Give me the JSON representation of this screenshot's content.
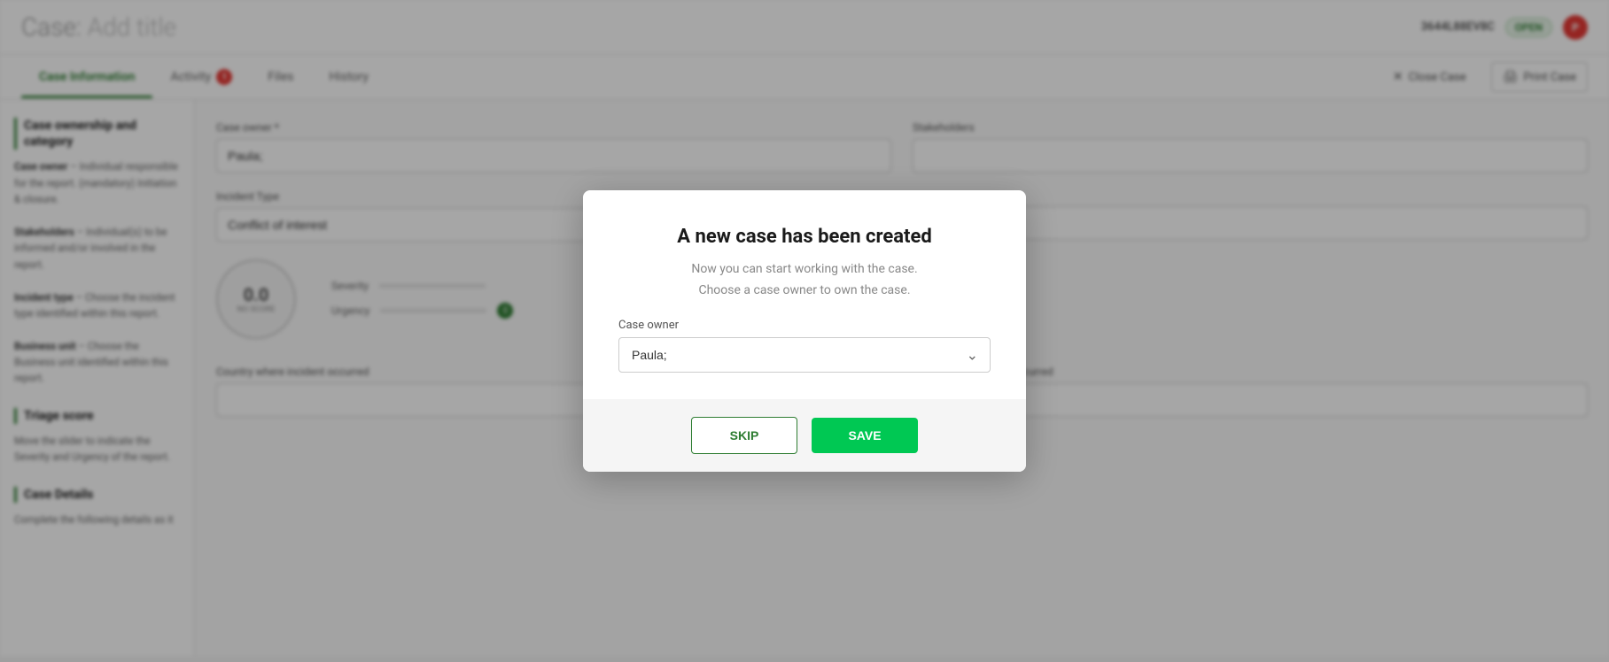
{
  "header": {
    "title_prefix": "Case:",
    "title_placeholder": "Add title",
    "case_id": "3644L88EV8C",
    "status": "OPEN",
    "avatar_initials": "P"
  },
  "tabs": [
    {
      "id": "case-information",
      "label": "Case Information",
      "active": true,
      "badge": null
    },
    {
      "id": "activity",
      "label": "Activity",
      "active": false,
      "badge": "1"
    },
    {
      "id": "files",
      "label": "Files",
      "active": false,
      "badge": null
    },
    {
      "id": "history",
      "label": "History",
      "active": false,
      "badge": null
    }
  ],
  "tabs_right": {
    "close_case": "Close Case",
    "print_case": "Print Case"
  },
  "sidebar": {
    "sections": [
      {
        "id": "case-ownership",
        "title": "Case ownership and category",
        "body": "Case owner – Individual responsible for the report. (mandatory) Initiation & closure.\nStakeholders – Individual(s) to be informed and/or involved in the report.\nIncident type – Choose the incident type identified within this report.\nBusiness unit – Choose the Business unit identified within this report."
      },
      {
        "id": "triage-score",
        "title": "Triage score",
        "body": "Move the slider to indicate the Severity and Urgency of the report."
      },
      {
        "id": "case-details",
        "title": "Case Details",
        "body": "Complete the following details as it"
      }
    ]
  },
  "form": {
    "case_owner_label": "Case owner *",
    "case_owner_value": "Paula;",
    "stakeholders_label": "Stakeholders",
    "incident_type_label": "Incident Type",
    "incident_type_value": "Conflict of interest",
    "triage_score": "0.0",
    "triage_no_score": "NO SCORE",
    "severity_label": "Severity",
    "urgency_label": "Urgency",
    "country_label": "Country where incident occurred",
    "state_label": "State where incident occurred"
  },
  "modal": {
    "title": "A new case has been created",
    "subtitle1": "Now you can start working with the case.",
    "subtitle2": "Choose a case owner to own the case.",
    "case_owner_label": "Case owner",
    "case_owner_value": "Paula;",
    "skip_label": "SKIP",
    "save_label": "SAVE"
  },
  "colors": {
    "active_tab": "#2e7d32",
    "save_btn": "#00c853",
    "badge_red": "#e53935",
    "avatar_red": "#e53935"
  }
}
